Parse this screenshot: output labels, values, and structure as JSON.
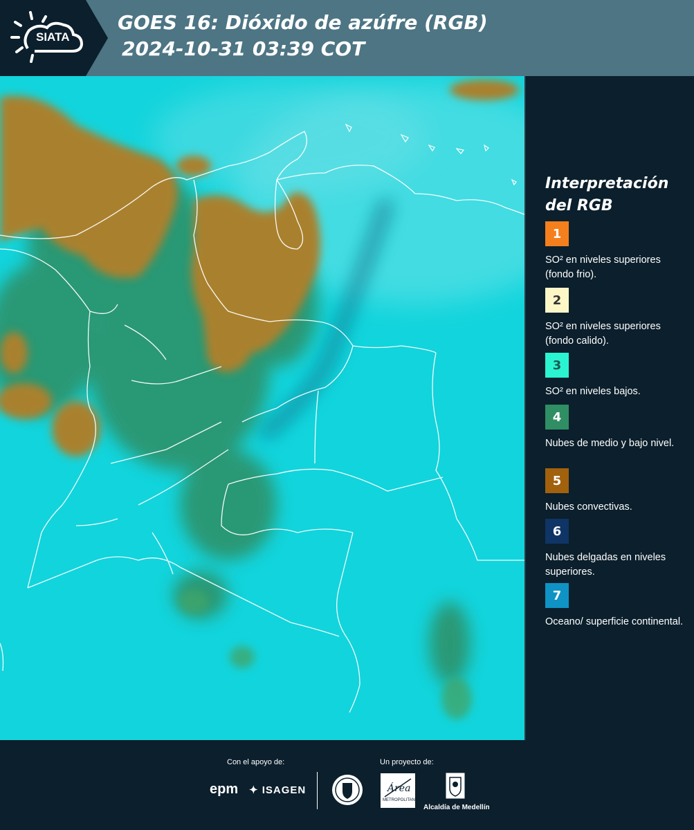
{
  "header": {
    "brand": "SIATA",
    "title_line1": "GOES 16: Dióxido de azúfre (RGB)",
    "title_line2": "2024-10-31 03:39 COT",
    "background_color": "#4d7584",
    "logo_background_color": "#0b1f2c"
  },
  "legend": {
    "title": "Interpretación del RGB",
    "items": [
      {
        "number": "1",
        "label": "SO² en niveles superiores (fondo frio).",
        "color": "#f57f1d",
        "text_color": "#ffffff"
      },
      {
        "number": "2",
        "label": "SO² en niveles superiores (fondo calido).",
        "color": "#fdf6c6",
        "text_color": "#333333"
      },
      {
        "number": "3",
        "label": "SO² en niveles bajos.",
        "color": "#2af5d0",
        "text_color": "#1d5a55"
      },
      {
        "number": "4",
        "label": "Nubes de medio y bajo nivel.",
        "color": "#2f8e63",
        "text_color": "#ffffff"
      },
      {
        "number": "5",
        "label": "Nubes convectivas.",
        "color": "#a2610d",
        "text_color": "#ffffff"
      },
      {
        "number": "6",
        "label": "Nubes delgadas en niveles superiores.",
        "color": "#0f3466",
        "text_color": "#ffffff"
      },
      {
        "number": "7",
        "label": "Oceano/ superficie continental.",
        "color": "#0f93c4",
        "text_color": "#ffffff"
      }
    ]
  },
  "map": {
    "ocean_land_color": "#12d4dc",
    "cold_cloud_color": "#a9812f",
    "mid_cloud_color": "#2f8e63",
    "border_color": "#ffffff"
  },
  "footer": {
    "support_label": "Con el apoyo de:",
    "project_label": "Un proyecto de:",
    "epm_logo_text": "epm",
    "isagen_logo_text": "ISAGEN",
    "area_logo_text": "Área",
    "area_logo_subtext": "METROPOLITANA",
    "alcaldia_label": "Alcaldía de Medellín"
  }
}
